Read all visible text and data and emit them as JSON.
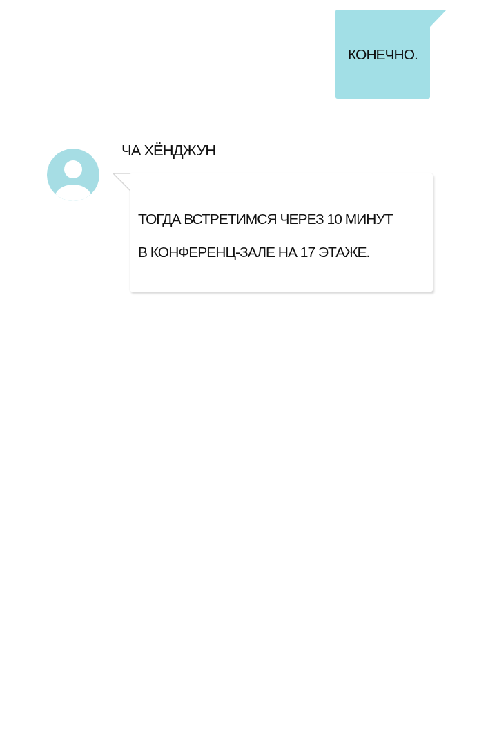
{
  "messages": [
    {
      "kind": "sent",
      "text": "КОНЕЧНО."
    },
    {
      "kind": "received",
      "sender": "ЧА ХЁНДЖУН",
      "lines": [
        "ТОГДА ВСТРЕТИМСЯ ЧЕРЕЗ 10 МИНУТ",
        "В КОНФЕРЕНЦ-ЗАЛЕ НА 17 ЭТАЖЕ."
      ]
    }
  ]
}
